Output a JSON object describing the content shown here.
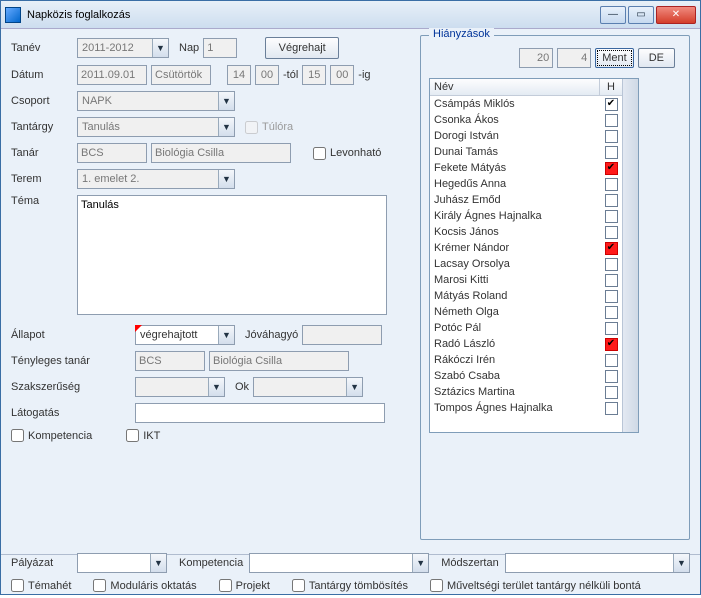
{
  "window": {
    "title": "Napközis foglalkozás"
  },
  "form": {
    "tanev_label": "Tanév",
    "tanev_value": "2011-2012",
    "nap_label": "Nap",
    "nap_value": "1",
    "vegrehajt_label": "Végrehajt",
    "datum_label": "Dátum",
    "datum_value": "2011.09.01",
    "datum_day": "Csütörtök",
    "ora_from": "14",
    "perc_from": "00",
    "tol_label": "-tól",
    "ora_to": "15",
    "perc_to": "00",
    "ig_label": "-ig",
    "csoport_label": "Csoport",
    "csoport_value": "NAPK",
    "tantargy_label": "Tantárgy",
    "tantargy_value": "Tanulás",
    "tulora_label": "Túlóra",
    "tanar_label": "Tanár",
    "tanar_code": "BCS",
    "tanar_name": "Biológia Csilla",
    "levonhato_label": "Levonható",
    "terem_label": "Terem",
    "terem_value": "1. emelet 2.",
    "tema_label": "Téma",
    "tema_value": "Tanulás",
    "allapot_label": "Állapot",
    "allapot_value": "végrehajtott",
    "jovahagyo_label": "Jóváhagyó",
    "jovahagyo_value": "",
    "tenyleges_label": "Tényleges tanár",
    "tenyleges_code": "BCS",
    "tenyleges_name": "Biológia Csilla",
    "szakszeruseg_label": "Szakszerűség",
    "szakszeruseg_value": "",
    "ok_label": "Ok",
    "ok_value": "",
    "latogatas_label": "Látogatás",
    "latogatas_value": "",
    "kompetencia_chk": "Kompetencia",
    "ikt_chk": "IKT"
  },
  "hianyzasok": {
    "legend": "Hiányzások",
    "count1": "20",
    "count2": "4",
    "ment_label": "Ment",
    "de_label": "DE",
    "col_nev": "Név",
    "col_h": "H",
    "rows": [
      {
        "name": "Csámpás Miklós",
        "h": true,
        "red": false
      },
      {
        "name": "Csonka Ákos",
        "h": false,
        "red": false
      },
      {
        "name": "Dorogi István",
        "h": false,
        "red": false
      },
      {
        "name": "Dunai Tamás",
        "h": false,
        "red": false
      },
      {
        "name": "Fekete Mátyás",
        "h": true,
        "red": true
      },
      {
        "name": "Hegedűs Anna",
        "h": false,
        "red": false
      },
      {
        "name": "Juhász Emőd",
        "h": false,
        "red": false
      },
      {
        "name": "Király Ágnes Hajnalka",
        "h": false,
        "red": false
      },
      {
        "name": "Kocsis János",
        "h": false,
        "red": false
      },
      {
        "name": "Krémer Nándor",
        "h": true,
        "red": true
      },
      {
        "name": "Lacsay Orsolya",
        "h": false,
        "red": false
      },
      {
        "name": "Marosi Kitti",
        "h": false,
        "red": false
      },
      {
        "name": "Mátyás Roland",
        "h": false,
        "red": false
      },
      {
        "name": "Németh Olga",
        "h": false,
        "red": false
      },
      {
        "name": "Potóc Pál",
        "h": false,
        "red": false
      },
      {
        "name": "Radó László",
        "h": true,
        "red": true
      },
      {
        "name": "Rákóczi Irén",
        "h": false,
        "red": false
      },
      {
        "name": "Szabó Csaba",
        "h": false,
        "red": false
      },
      {
        "name": "Sztázics Martina",
        "h": false,
        "red": false
      },
      {
        "name": "Tompos Ágnes Hajnalka",
        "h": false,
        "red": false
      }
    ]
  },
  "bottom": {
    "palyazat_label": "Pályázat",
    "kompetencia_label": "Kompetencia",
    "modszertan_label": "Módszertan",
    "temahet": "Témahét",
    "modularis": "Moduláris oktatás",
    "projekt": "Projekt",
    "tombosites": "Tantárgy tömbösítés",
    "muveltsegi": "Műveltségi terület tantárgy nélküli bontá"
  }
}
